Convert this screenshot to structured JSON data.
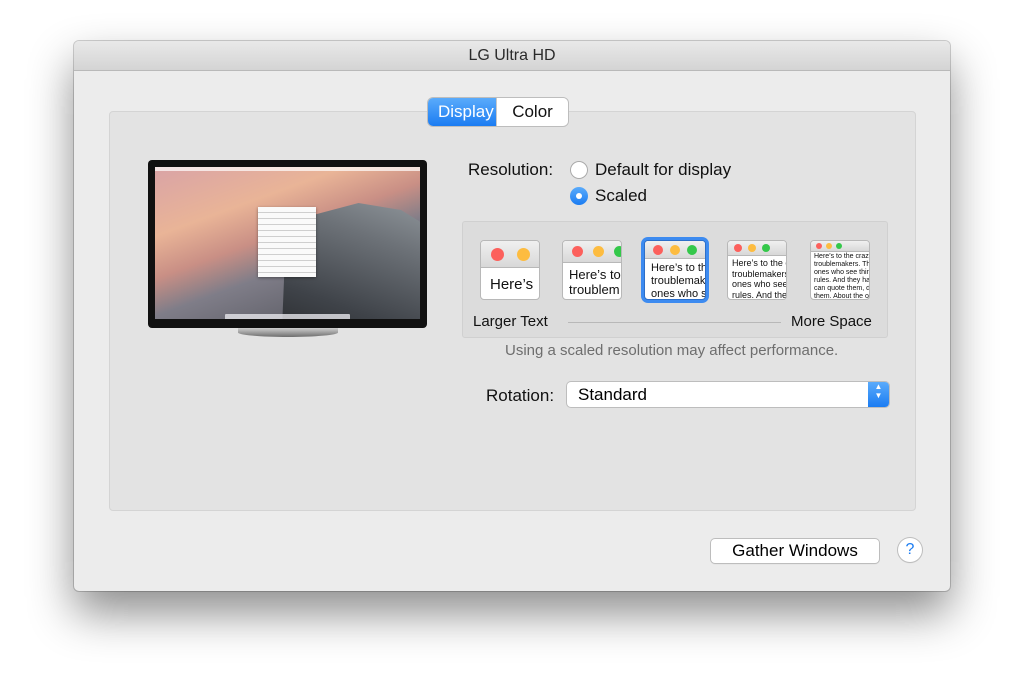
{
  "window": {
    "title": "LG Ultra HD"
  },
  "tabs": [
    {
      "label": "Display",
      "active": true
    },
    {
      "label": "Color",
      "active": false
    }
  ],
  "resolution": {
    "label": "Resolution:",
    "options": [
      {
        "label": "Default for display",
        "selected": false
      },
      {
        "label": "Scaled",
        "selected": true
      }
    ]
  },
  "scaling": {
    "thumbnails": [
      {
        "text": "Here’s"
      },
      {
        "text": "Here’s to\ntroublem"
      },
      {
        "text": "Here’s to th\ntroublemak\nones who s"
      },
      {
        "text": "Here’s to the cr\ntroublemakers.\nones who see t\nrules. And they"
      },
      {
        "text": "Here’s to the crazy one\ntroublemakers. The rou\nones who see things di\nrules. And they have no\ncan quote them, disagr\nthem. About the only th\nBecause they change t"
      }
    ],
    "selected_index": 2,
    "left_label": "Larger Text",
    "right_label": "More Space",
    "note": "Using a scaled resolution may affect performance."
  },
  "rotation": {
    "label": "Rotation:",
    "value": "Standard"
  },
  "footer": {
    "gather_label": "Gather Windows",
    "help_label": "?"
  },
  "colors": {
    "accent": "#1b7cf2",
    "traffic_red": "#fc605c",
    "traffic_yellow": "#fdbc40",
    "traffic_green": "#34c84a"
  }
}
